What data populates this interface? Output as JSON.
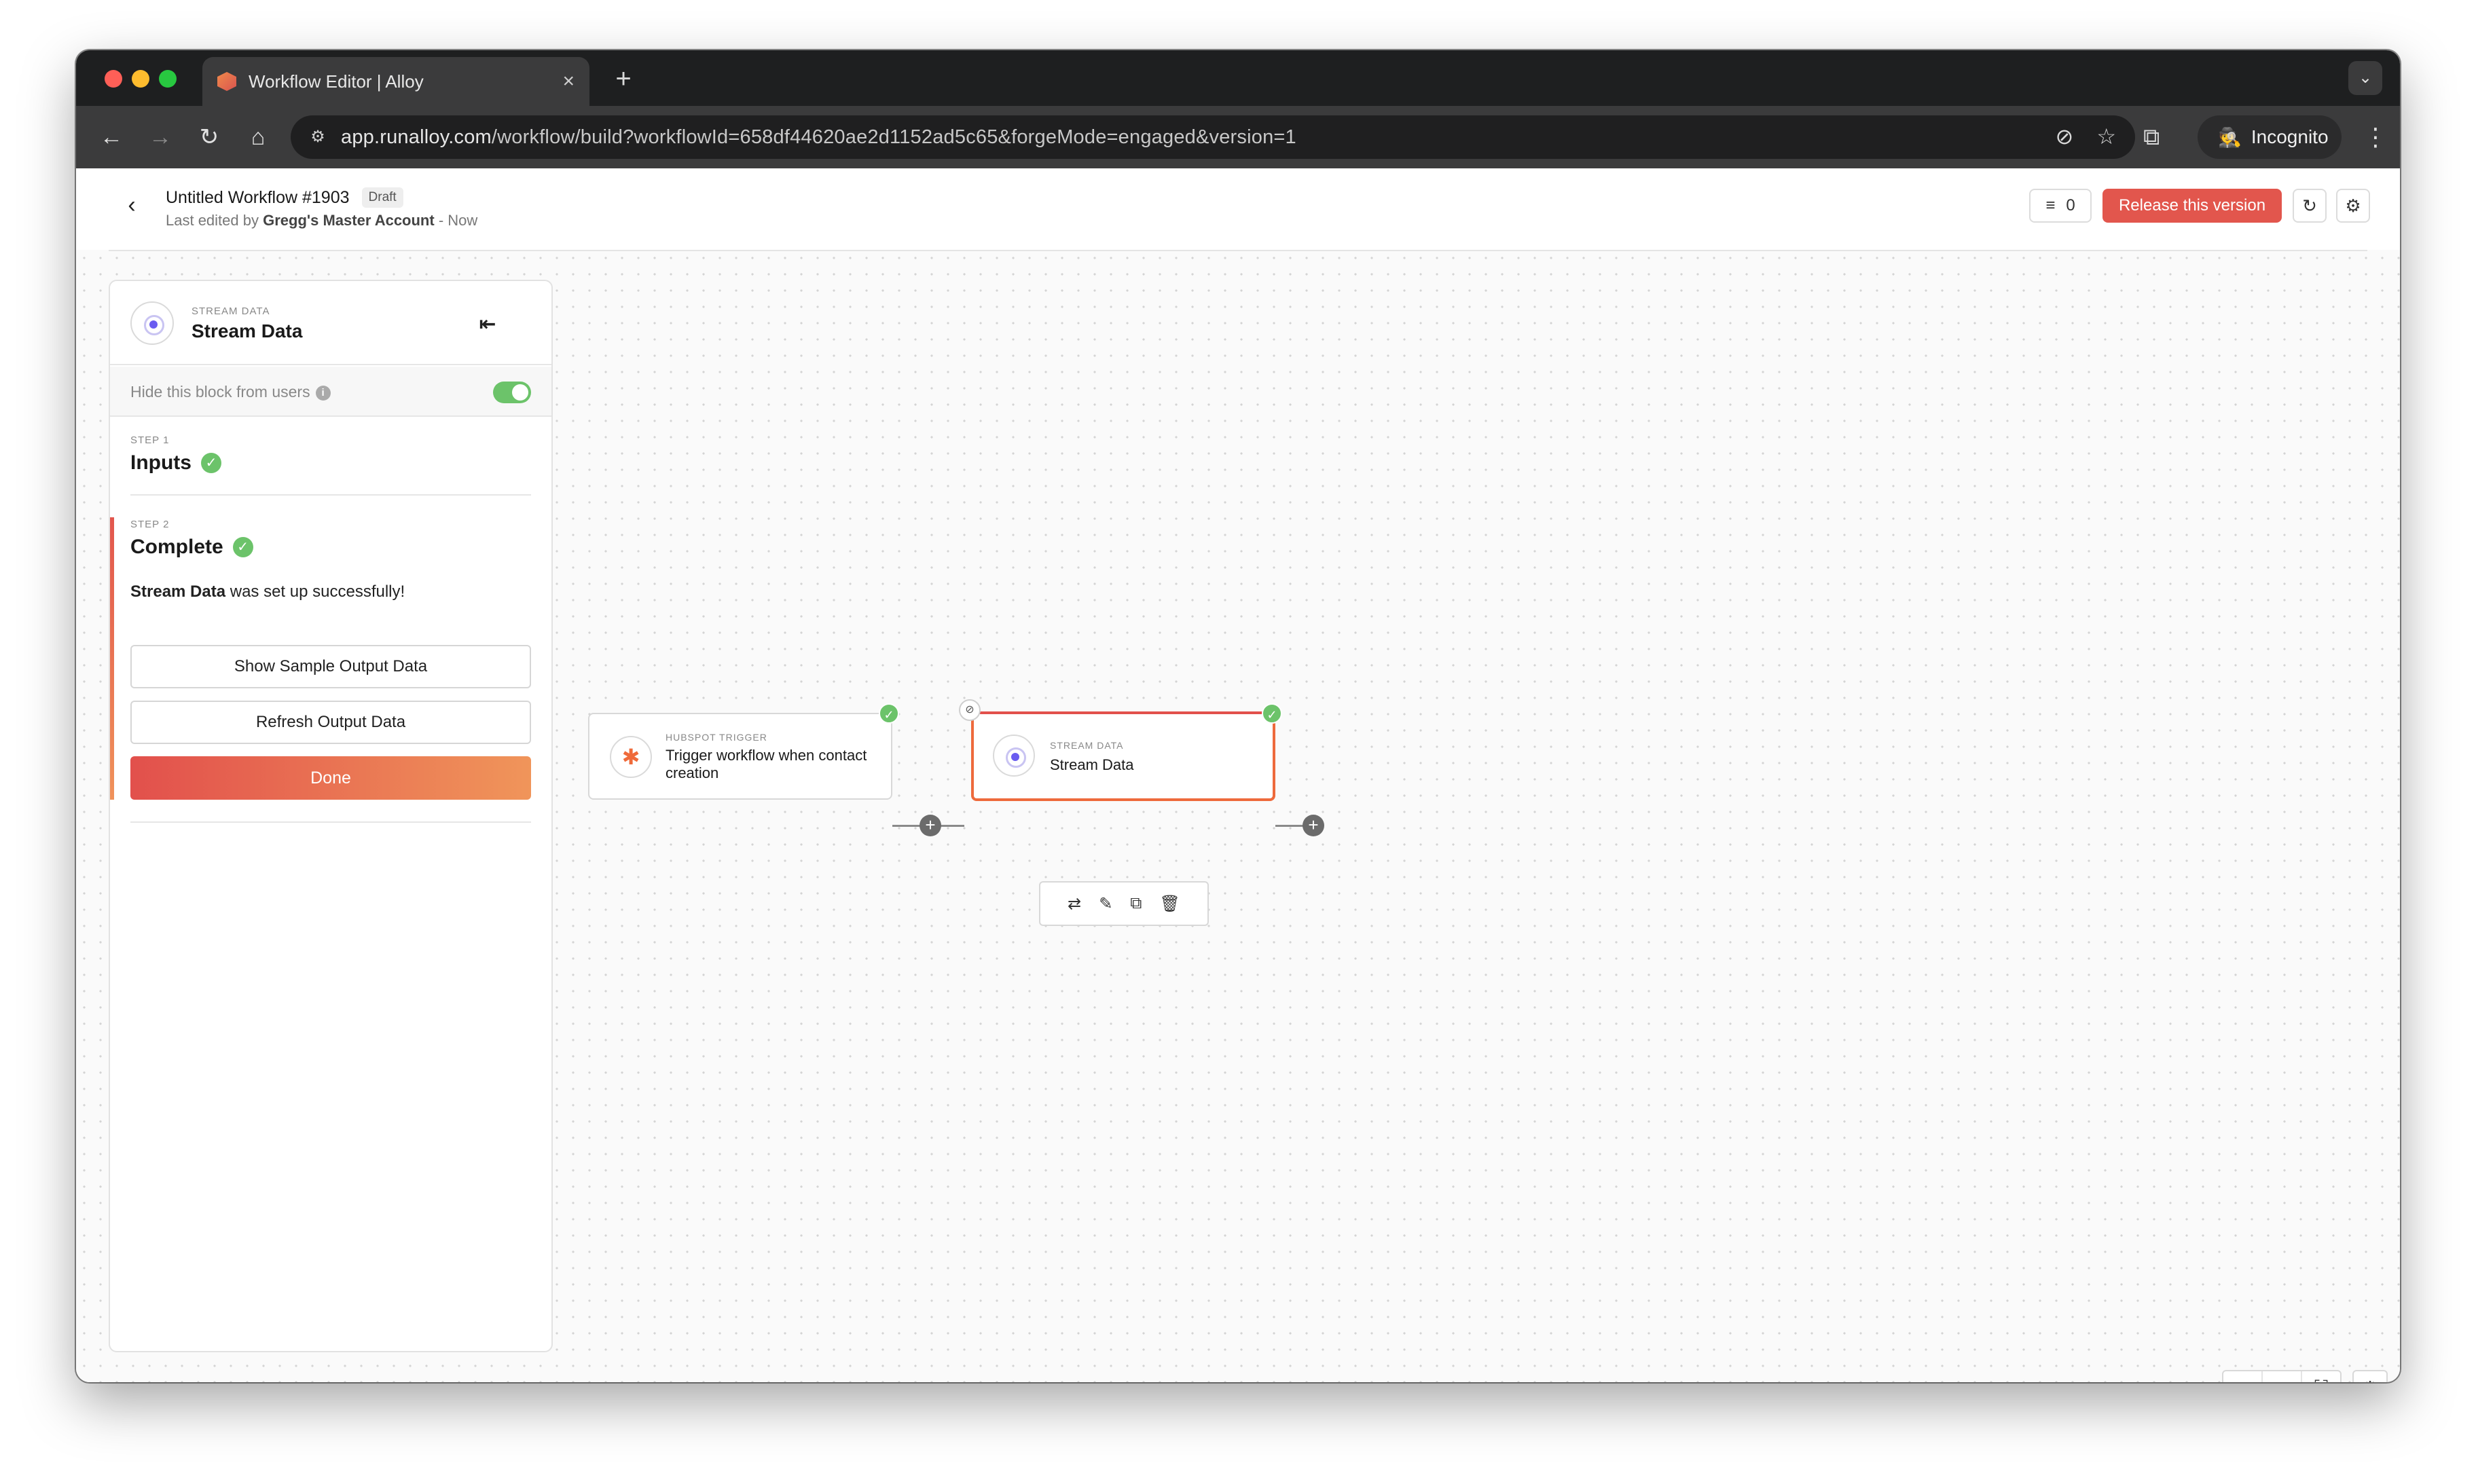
{
  "browser": {
    "tab_title": "Workflow Editor | Alloy",
    "tab_close": "×",
    "new_tab": "+",
    "url_host": "app.runalloy.com",
    "url_path": "/workflow/build?workflowId=658df44620ae2d1152ad5c65&forgeMode=engaged&version=1",
    "incognito_label": "Incognito",
    "icons": [
      "back-icon",
      "forward-icon",
      "reload-icon",
      "home-icon",
      "site-info-icon",
      "eye-off-icon",
      "star-icon",
      "extensions-icon",
      "side-panel-icon",
      "incognito-icon",
      "kebab-menu-icon"
    ]
  },
  "header": {
    "title": "Untitled Workflow #1903",
    "badge": "Draft",
    "subtitle_prefix": "Last edited by ",
    "subtitle_user": "Gregg's Master Account",
    "subtitle_suffix": " - Now",
    "count": "0",
    "release_button": "Release this version"
  },
  "panel": {
    "kicker": "STREAM DATA",
    "title": "Stream Data",
    "hide_label": "Hide this block from users",
    "hide_enabled": true,
    "step1_kicker": "STEP 1",
    "step1_title": "Inputs",
    "step2_kicker": "STEP 2",
    "step2_title": "Complete",
    "success_name": "Stream Data",
    "success_text": " was set up successfully!",
    "show_sample_button": "Show Sample Output Data",
    "refresh_button": "Refresh Output Data",
    "done_button": "Done"
  },
  "canvas": {
    "nodes": [
      {
        "kicker": "HUBSPOT TRIGGER",
        "title": "Trigger workflow when contact creation",
        "status": "complete"
      },
      {
        "kicker": "STREAM DATA",
        "title": "Stream Data",
        "status": "complete",
        "selected": true,
        "hidden_from_users": true
      }
    ],
    "node_toolbar_icons": [
      "swap-icon",
      "edit-icon",
      "duplicate-icon",
      "delete-icon"
    ],
    "zoom_controls": [
      "+",
      "−",
      "fullscreen-icon"
    ],
    "settings_icon": "gear-icon"
  },
  "colors": {
    "accent": "#e2564d",
    "accent_end": "#f0955a",
    "success": "#6cc36a",
    "stream_icon": "#6a5cf0"
  }
}
